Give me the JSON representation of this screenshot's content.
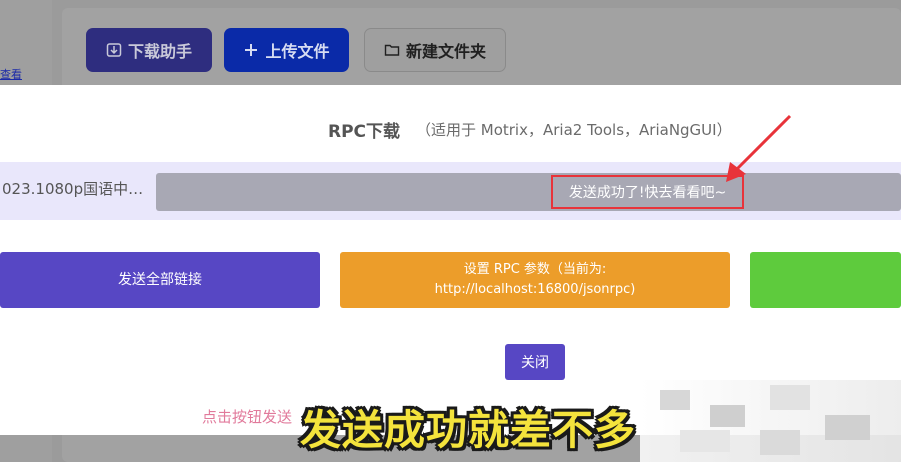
{
  "background": {
    "left_link": "查看",
    "toolbar": {
      "download_helper": "下载助手",
      "upload_file": "上传文件",
      "new_folder": "新建文件夹"
    }
  },
  "modal": {
    "title": "RPC下载",
    "title_sub": "（适用于 Motrix，Aria2 Tools，AriaNgGUI）",
    "file_name": "023.1080p国语中…",
    "toast": "发送成功了!快去看看吧~",
    "buttons": {
      "send_all": "发送全部链接",
      "rpc_line1": "设置 RPC 参数（当前为:",
      "rpc_line2": "http://localhost:16800/jsonrpc)",
      "close": "关闭"
    },
    "hint": "点击按钮发送"
  },
  "caption": "发送成功就差不多",
  "colors": {
    "accent_purple": "#5747c4",
    "accent_orange": "#ec9d2a",
    "accent_green": "#5ecb3d",
    "highlight_red": "#e8333a"
  }
}
